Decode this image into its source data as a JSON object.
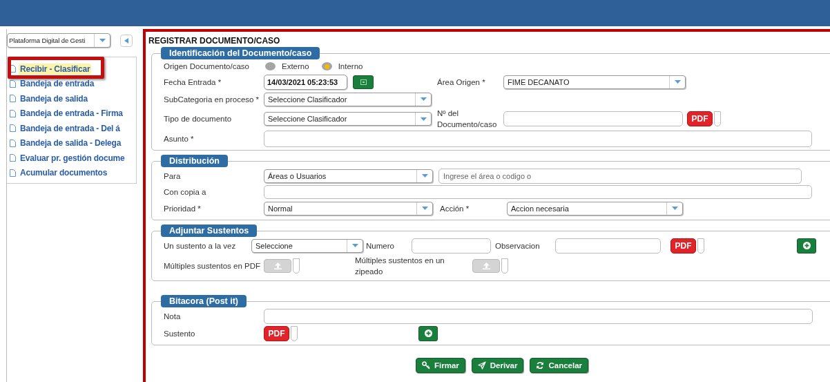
{
  "sidebar": {
    "module_select": {
      "value": "Plataforma Digital de Gesti"
    },
    "items": [
      {
        "label": "Recibir - Clasificar",
        "selected": true
      },
      {
        "label": "Bandeja de entrada",
        "selected": false
      },
      {
        "label": "Bandeja de salida",
        "selected": false
      },
      {
        "label": "Bandeja de entrada - Firma",
        "selected": false
      },
      {
        "label": "Bandeja de entrada - Del á",
        "selected": false
      },
      {
        "label": "Bandeja de salida - Delega",
        "selected": false
      },
      {
        "label": "Evaluar pr. gestión docume",
        "selected": false
      },
      {
        "label": "Acumular documentos",
        "selected": false
      }
    ]
  },
  "form": {
    "title": "REGISTRAR DOCUMENTO/CASO",
    "identificacion": {
      "title": "Identificación del Documento/caso",
      "origen": {
        "label": "Origen Documento/caso",
        "options": [
          {
            "label": "Externo",
            "selected": false
          },
          {
            "label": "Interno",
            "selected": true
          }
        ]
      },
      "fecha_entrada": {
        "label": "Fecha Entrada *",
        "value": "14/03/2021 05:23:53"
      },
      "area_origen": {
        "label": "Área Origen  *",
        "value": "FIME DECANATO"
      },
      "subcategoria": {
        "label": "SubCategoria en proceso *",
        "value": "Seleccione Clasificador"
      },
      "tipo_documento": {
        "label": "Tipo de documento",
        "value": "Seleccione Clasificador"
      },
      "numero_documento": {
        "label": "Nº del Documento/caso",
        "button": "PDF"
      },
      "asunto": {
        "label": "Asunto *"
      }
    },
    "distribucion": {
      "title": "Distribución",
      "para": {
        "label": "Para",
        "value": "Áreas o Usuarios",
        "search_placeholder": "Ingrese el área o codigo o"
      },
      "con_copia": {
        "label": "Con copia a"
      },
      "prioridad": {
        "label": "Prioridad *",
        "value": "Normal"
      },
      "accion": {
        "label": "Acción *",
        "value": "Accion necesaria"
      }
    },
    "adjuntar": {
      "title": "Adjuntar Sustentos",
      "un_sustento": {
        "label": "Un sustento a la vez",
        "value": "Seleccione"
      },
      "numero": {
        "label": "Numero"
      },
      "observacion": {
        "label": "Observacion",
        "button": "PDF"
      },
      "multiples_pdf": {
        "label": "Múltiples sustentos en PDF"
      },
      "multiples_zip": {
        "label": "Múltiples sustentos en un zipeado"
      }
    },
    "bitacora": {
      "title": "Bitacora (Post it)",
      "nota": {
        "label": "Nota"
      },
      "sustento": {
        "label": "Sustento",
        "button": "PDF"
      }
    },
    "buttons": [
      "Firmar",
      "Derivar",
      "Cancelar"
    ]
  }
}
